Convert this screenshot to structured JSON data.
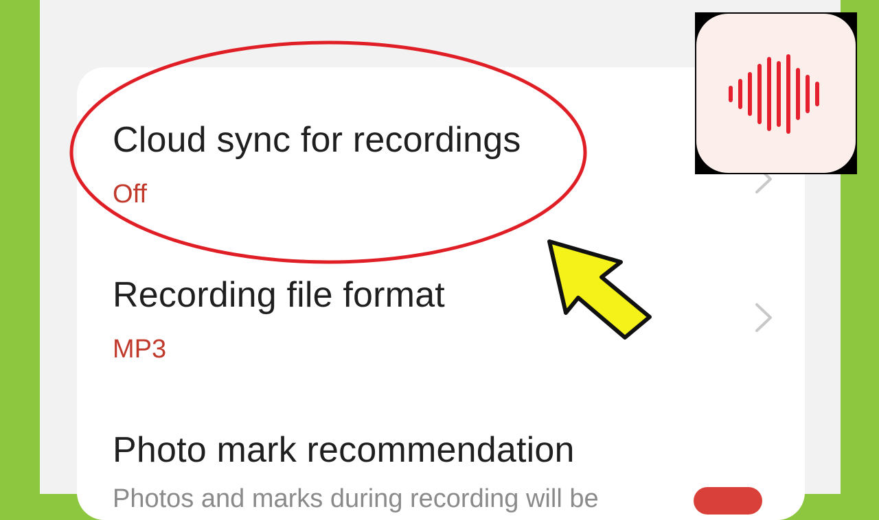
{
  "settings": {
    "items": [
      {
        "title": "Cloud sync for recordings",
        "value": "Off"
      },
      {
        "title": "Recording file format",
        "value": "MP3"
      },
      {
        "title": "Photo mark recommendation",
        "description": "Photos and marks during recording will be"
      }
    ]
  },
  "icons": {
    "chevron": "chevron-right-icon",
    "app": "sound-recorder-waveform-icon",
    "arrow": "yellow-pointer-arrow"
  },
  "colors": {
    "background_border": "#8dc63f",
    "value_text": "#c0392b",
    "highlight": "#e01e25",
    "arrow": "#f5f21a",
    "toggle_on": "#d9403a",
    "app_waveform": "#e5202e"
  }
}
